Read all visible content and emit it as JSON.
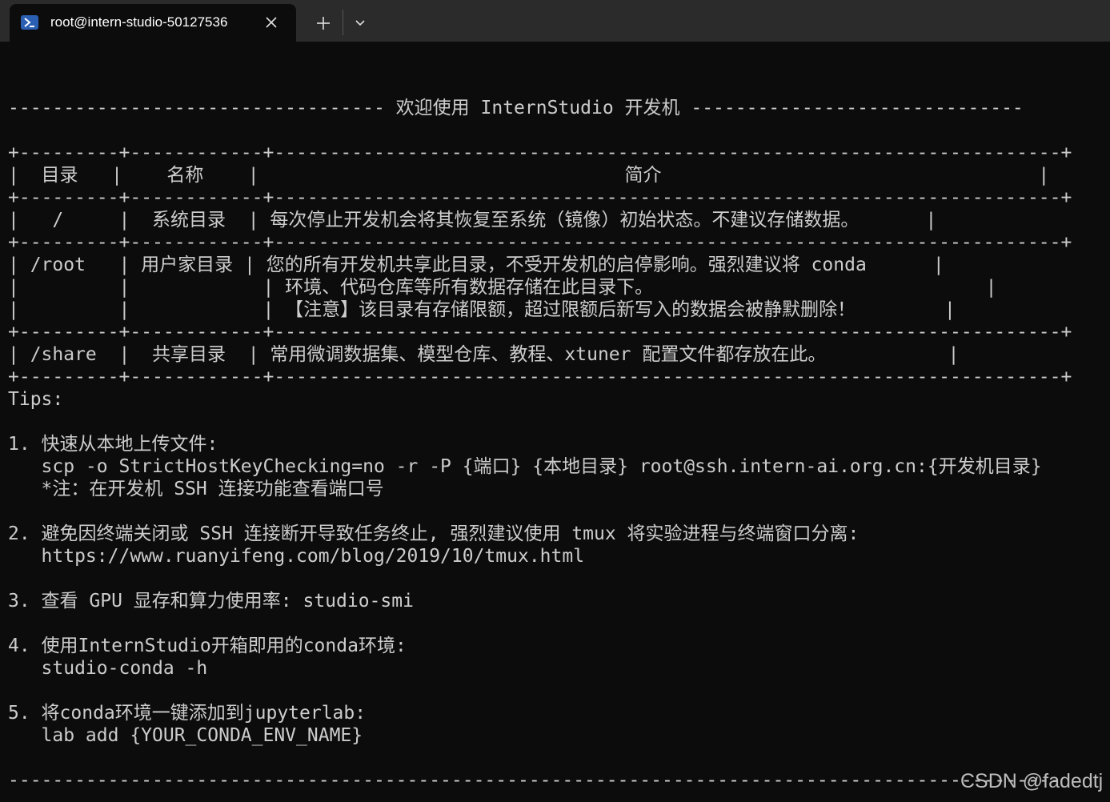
{
  "tab": {
    "title": "root@intern-studio-50127536",
    "icon": "powershell-icon"
  },
  "toolbar": {
    "new_tab_icon": "plus-icon",
    "dropdown_icon": "chevron-down-icon"
  },
  "terminal": {
    "lines": [
      "---------------------------------- 欢迎使用 InternStudio 开发机 ------------------------------",
      "+---------+------------+-----------------------------------------------------------------------+",
      "|  目录   |    名称    |                                 简介                                  |",
      "+---------+------------+-----------------------------------------------------------------------+",
      "|   /     |  系统目录  | 每次停止开发机会将其恢复至系统（镜像）初始状态。不建议存储数据。      |",
      "+---------+------------+-----------------------------------------------------------------------+",
      "| /root   | 用户家目录 | 您的所有开发机共享此目录，不受开发机的启停影响。强烈建议将 conda      |",
      "|         |            | 环境、代码仓库等所有数据存储在此目录下。                              |",
      "|         |            | 【注意】该目录有存储限额，超过限额后新写入的数据会被静默删除！        |",
      "+---------+------------+-----------------------------------------------------------------------+",
      "| /share  |  共享目录  | 常用微调数据集、模型仓库、教程、xtuner 配置文件都存放在此。           |",
      "+---------+------------+-----------------------------------------------------------------------+",
      "Tips:",
      "",
      "1. 快速从本地上传文件:",
      "   scp -o StrictHostKeyChecking=no -r -P {端口} {本地目录} root@ssh.intern-ai.org.cn:{开发机目录}",
      "   *注：在开发机 SSH 连接功能查看端口号",
      "",
      "2. 避免因终端关闭或 SSH 连接断开导致任务终止, 强烈建议使用 tmux 将实验进程与终端窗口分离:",
      "   https://www.ruanyifeng.com/blog/2019/10/tmux.html",
      "",
      "3. 查看 GPU 显存和算力使用率: studio-smi",
      "",
      "4. 使用InternStudio开箱即用的conda环境:",
      "   studio-conda -h",
      "",
      "5. 将conda环境一键添加到jupyterlab:",
      "   lab add {YOUR_CONDA_ENV_NAME}",
      "",
      "-----------------------------------------------------------------------------------------------"
    ]
  },
  "watermark": "CSDN @fadedtj"
}
